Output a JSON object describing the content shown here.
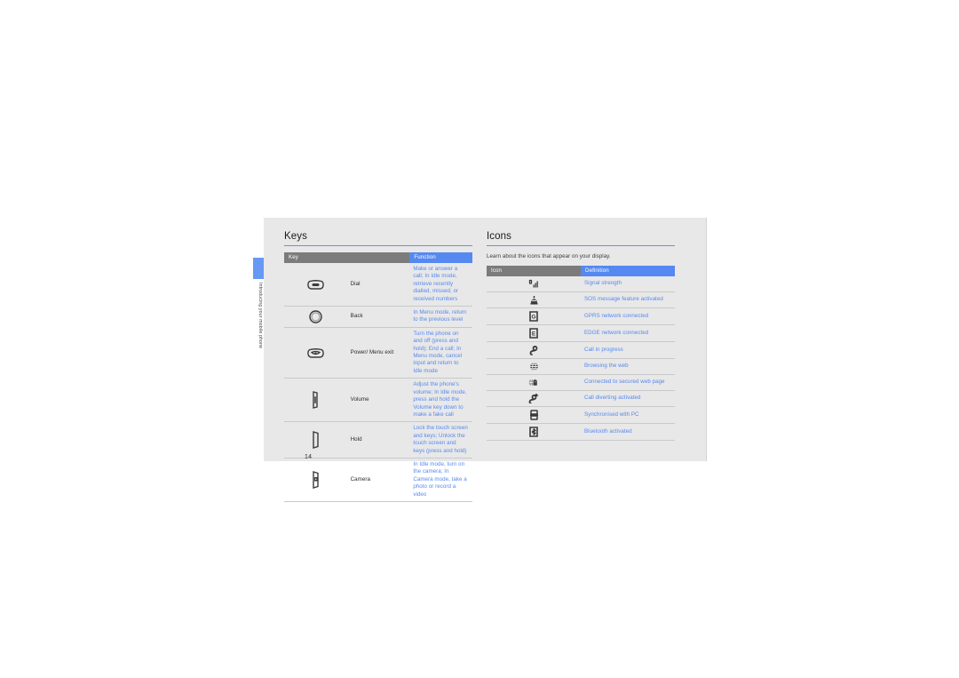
{
  "page": {
    "number": "14",
    "chapter_label": "Introducing your mobile phone",
    "tab_color": "#6699f5",
    "sheet_color": "#e8e8e8",
    "accent_blue": "#5588f0",
    "header_gray": "#7b7b7b"
  },
  "keys_section": {
    "title": "Keys",
    "table": {
      "headers": [
        "Key",
        "Function"
      ],
      "rows": [
        {
          "icon": "dial-key-icon",
          "name": "Dial",
          "function": "Make or answer a call; In Idle mode, retrieve recently dialled, missed, or received numbers"
        },
        {
          "icon": "back-key-icon",
          "name": "Back",
          "function": "In Menu mode, return to the previous level"
        },
        {
          "icon": "power-menu-exit-key-icon",
          "name": "Power/ Menu exit",
          "function": "Turn the phone on and off (press and hold); End a call; In Menu mode, cancel input and return to Idle mode"
        },
        {
          "icon": "volume-key-icon",
          "name": "Volume",
          "function": "Adjust the phone's volume; In Idle mode, press and hold the Volume key down to make a fake call"
        },
        {
          "icon": "hold-key-icon",
          "name": "Hold",
          "function": "Lock the touch screen and keys; Unlock the touch screen and keys (press and hold)"
        },
        {
          "icon": "camera-key-icon",
          "name": "Camera",
          "function": "In Idle mode, turn on the camera; In Camera mode, take a photo or record a video"
        }
      ]
    }
  },
  "icons_section": {
    "title": "Icons",
    "intro": "Learn about the icons that appear on your display.",
    "table": {
      "headers": [
        "Icon",
        "Definition"
      ],
      "rows": [
        {
          "icon": "signal-strength-icon",
          "definition": "Signal strength"
        },
        {
          "icon": "sos-message-icon",
          "definition": "SOS message feature activated"
        },
        {
          "icon": "gprs-network-icon",
          "definition": "GPRS network connected"
        },
        {
          "icon": "edge-network-icon",
          "definition": "EDGE network connected"
        },
        {
          "icon": "call-in-progress-icon",
          "definition": "Call in progress"
        },
        {
          "icon": "browsing-web-icon",
          "definition": "Browsing the web"
        },
        {
          "icon": "secured-web-page-icon",
          "definition": "Connected to secured web page"
        },
        {
          "icon": "call-diverting-icon",
          "definition": "Call diverting activated"
        },
        {
          "icon": "synchronised-pc-icon",
          "definition": "Synchronised with PC"
        },
        {
          "icon": "bluetooth-activated-icon",
          "definition": "Bluetooth activated"
        }
      ]
    }
  }
}
